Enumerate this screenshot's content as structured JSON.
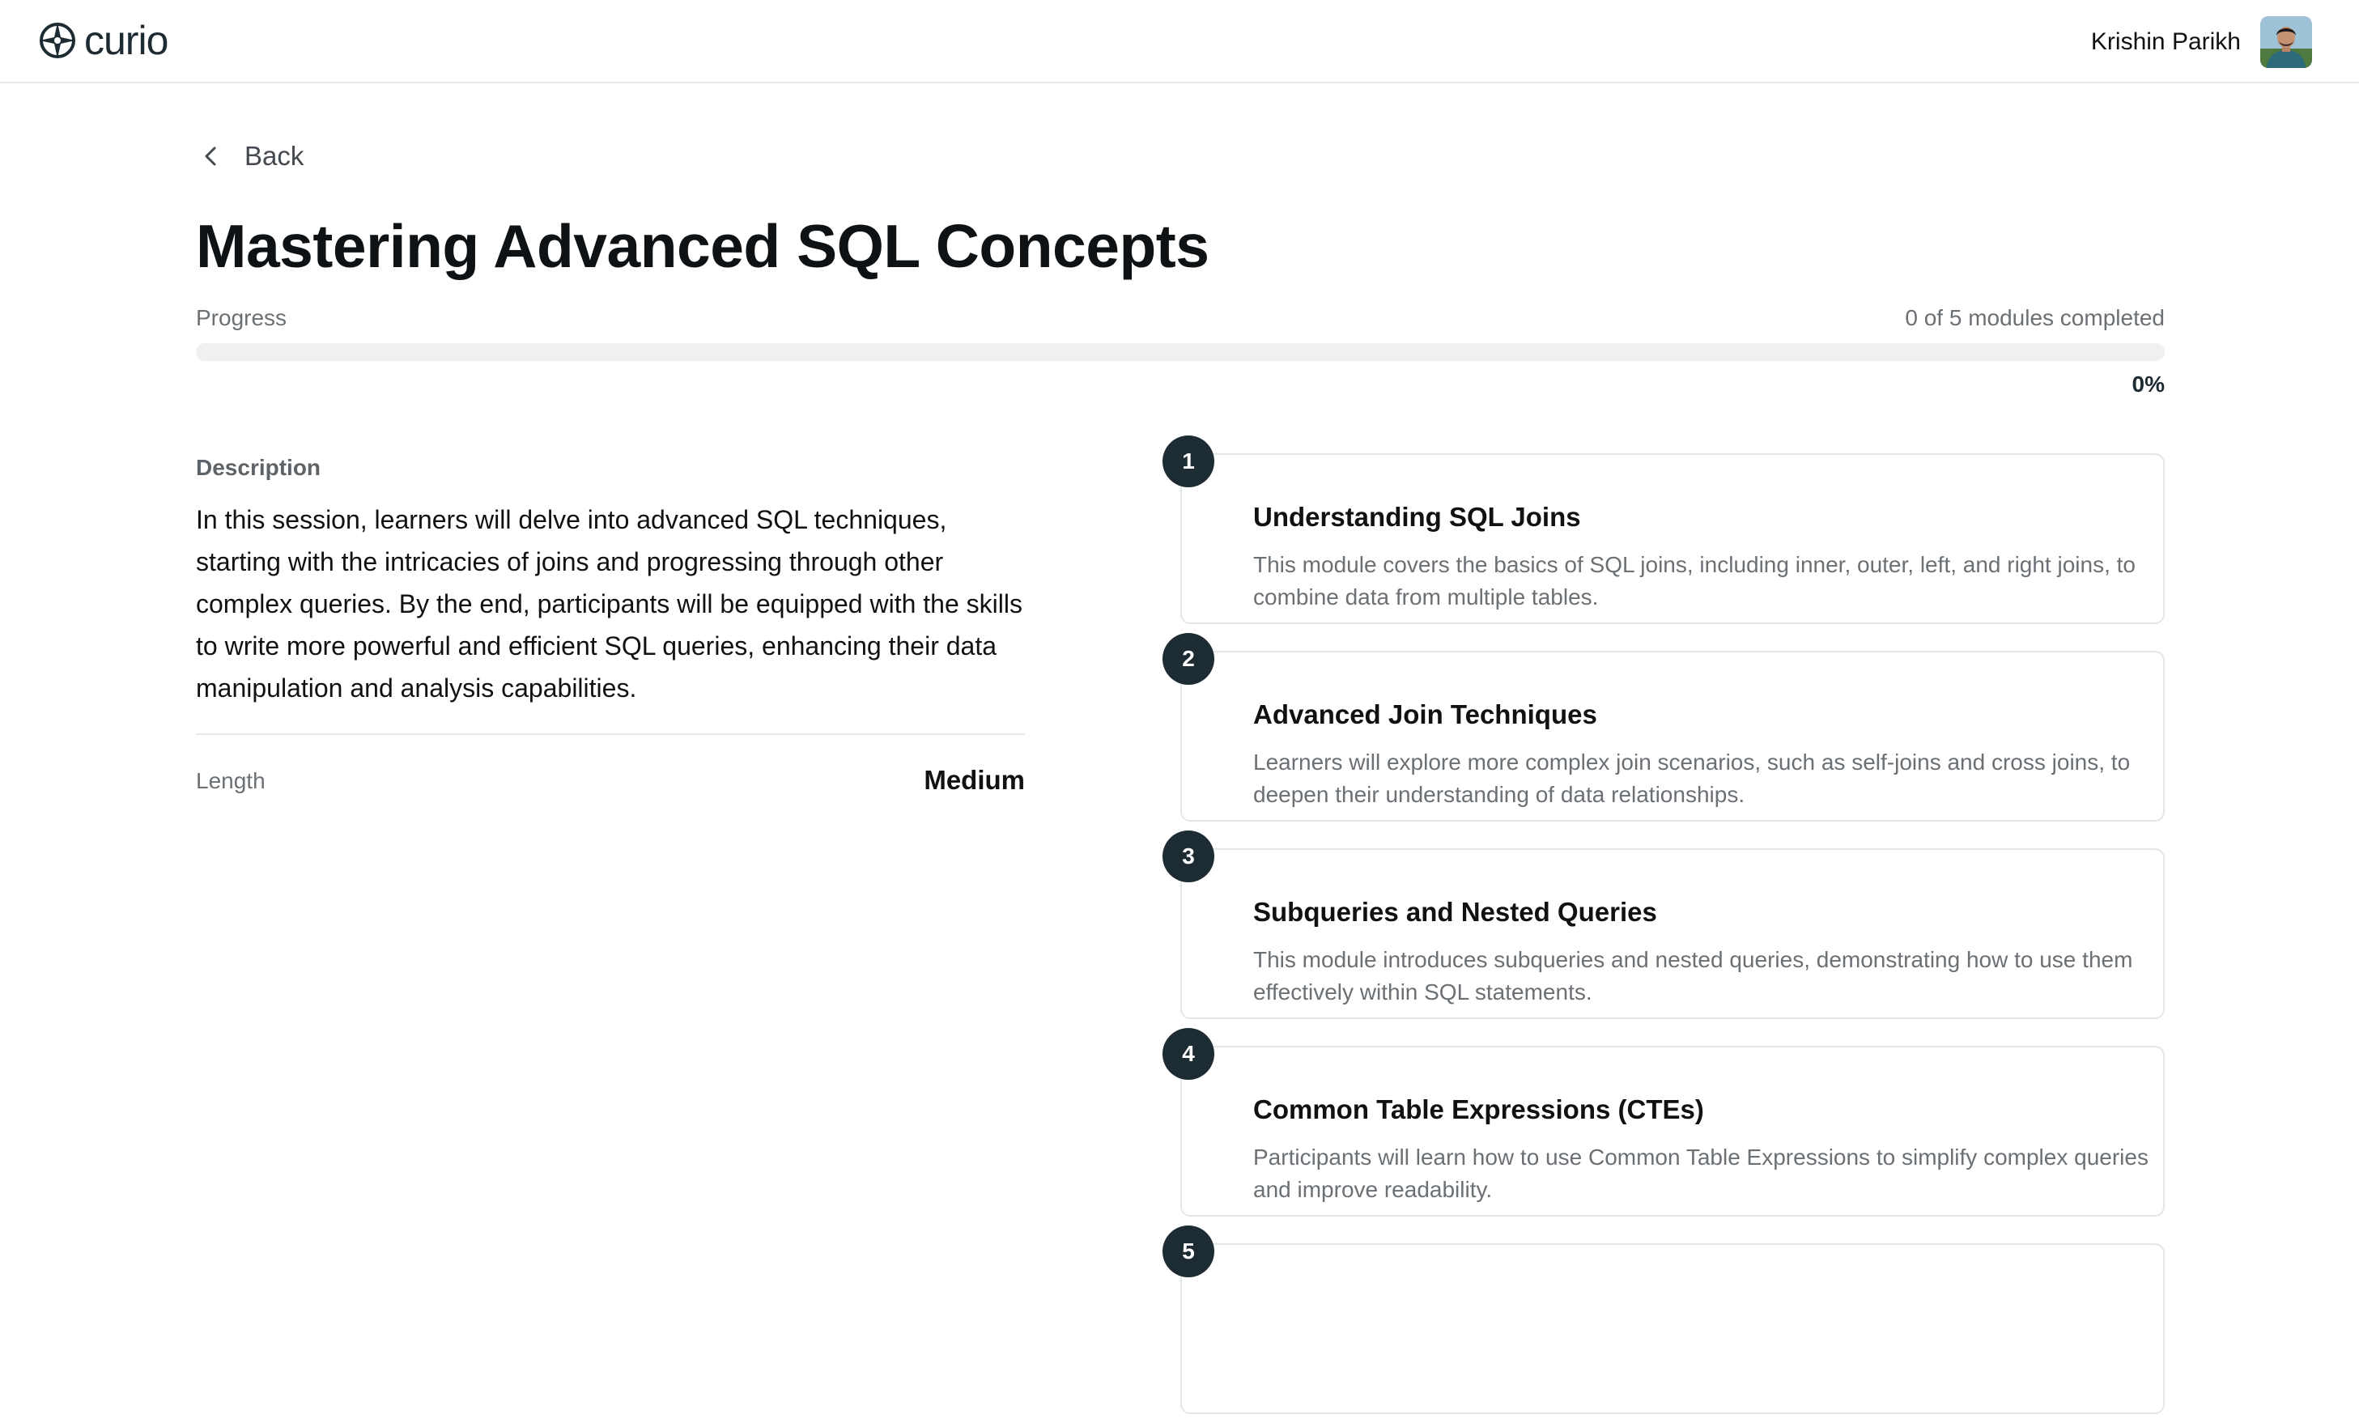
{
  "app": {
    "brand": "curio",
    "user_name": "Krishin Parikh"
  },
  "nav": {
    "back_label": "Back"
  },
  "course": {
    "title": "Mastering Advanced SQL Concepts",
    "progress_label": "Progress",
    "progress_count_text": "0 of 5 modules completed",
    "progress_percent_text": "0%",
    "progress_fraction": 0,
    "description_heading": "Description",
    "description": "In this session, learners will delve into advanced SQL techniques, starting with the intricacies of joins and progressing through other complex queries. By the end, participants will be equipped with the skills to write more powerful and efficient SQL queries, enhancing their data manipulation and analysis capabilities.",
    "length_label": "Length",
    "length_value": "Medium"
  },
  "modules": [
    {
      "number": "1",
      "title": "Understanding SQL Joins",
      "description": "This module covers the basics of SQL joins, including inner, outer, left, and right joins, to combine data from multiple tables."
    },
    {
      "number": "2",
      "title": "Advanced Join Techniques",
      "description": "Learners will explore more complex join scenarios, such as self-joins and cross joins, to deepen their understanding of data relationships."
    },
    {
      "number": "3",
      "title": "Subqueries and Nested Queries",
      "description": "This module introduces subqueries and nested queries, demonstrating how to use them effectively within SQL statements."
    },
    {
      "number": "4",
      "title": "Common Table Expressions (CTEs)",
      "description": "Participants will learn how to use Common Table Expressions to simplify complex queries and improve readability."
    },
    {
      "number": "5",
      "title": "",
      "description": ""
    }
  ],
  "icons": {
    "logo": "compass-star-logo-icon",
    "back": "chevron-left-icon",
    "avatar": "user-avatar-photo"
  },
  "colors": {
    "accent": "#1d2b33",
    "text_primary": "#111111",
    "text_muted": "#6b7075",
    "border": "#e4e6e8",
    "track": "#eff0f1"
  }
}
